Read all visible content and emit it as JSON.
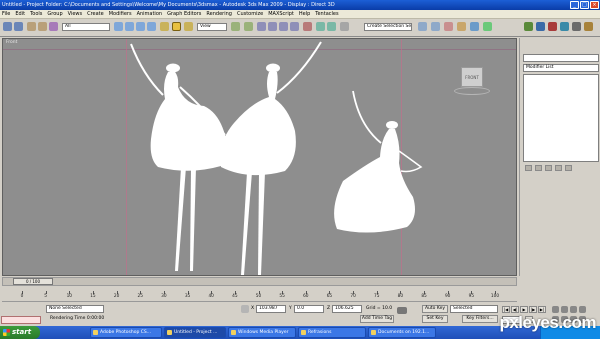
{
  "window": {
    "title": "Untitled    - Project Folder: C:\\Documents and Settings\\Welcome\\My Documents\\3dsmax    - Autodesk 3ds Max  2009          - Display : Direct 3D",
    "minimize": "_",
    "maximize": "□",
    "close": "×"
  },
  "menu": [
    "File",
    "Edit",
    "Tools",
    "Group",
    "Views",
    "Create",
    "Modifiers",
    "Animation",
    "Graph Editors",
    "Rendering",
    "Customize",
    "MAXScript",
    "Help",
    "Tentacles"
  ],
  "toolbar": {
    "selection_filter": "All",
    "reference_coord": "View",
    "named_selection": "Create Selection Set"
  },
  "viewport": {
    "label": "Front",
    "viewcube_label": "FRONT"
  },
  "command_panel": {
    "modifier_list": "Modifier List"
  },
  "timeline": {
    "frame_indicator": "0 / 100",
    "ticks": [
      "0",
      "5",
      "10",
      "15",
      "20",
      "25",
      "30",
      "35",
      "40",
      "45",
      "50",
      "55",
      "60",
      "65",
      "70",
      "75",
      "80",
      "85",
      "90",
      "95",
      "100"
    ]
  },
  "status": {
    "selection": "None Selected",
    "prompt": "Rendering Time  0:00:00",
    "x_label": "X",
    "x_value": "103.987",
    "y_label": "Y",
    "y_value": "0.0",
    "z_label": "Z",
    "z_value": "106.625",
    "grid": "Grid = 10.0",
    "add_time_tag": "Add Time Tag",
    "auto_key": "Auto Key",
    "set_key": "Set Key",
    "key_mode": "Selected",
    "key_filters": "Key Filters..."
  },
  "playback": [
    "|◀",
    "◀|",
    "▶",
    "|▶",
    "▶|"
  ],
  "taskbar": {
    "start": "start",
    "tasks": [
      "Adobe Photoshop CS...",
      "Untitled    - Project ...",
      "Windows Media Player",
      "Refrasions",
      "Documents on 192.1..."
    ]
  },
  "watermark": "pxleyes.com",
  "colors": {
    "title_bar": "#0a3ca8",
    "viewport_bg": "#8e8e8e",
    "figure_fill": "#ffffff",
    "taskbar": "#2a5fd0",
    "start_button": "#2f8a2f"
  }
}
